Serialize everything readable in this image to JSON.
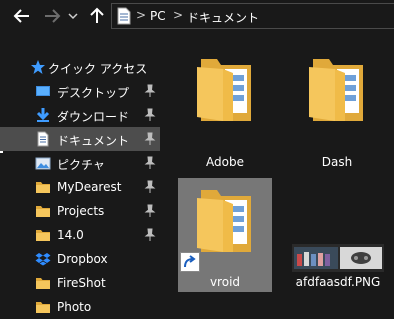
{
  "nav": {
    "back_icon": "back-arrow-icon",
    "forward_icon": "forward-arrow-icon",
    "down_icon": "chevron-down-icon",
    "up_icon": "up-arrow-icon"
  },
  "address": {
    "icon": "document-icon",
    "crumbs": [
      "PC",
      "ドキュメント"
    ],
    "separator": ">"
  },
  "sidebar": {
    "quick_access": {
      "label": "クイック アクセス",
      "icon": "star-icon"
    },
    "items": [
      {
        "label": "デスクトップ",
        "icon": "desktop-icon",
        "pinned": true
      },
      {
        "label": "ダウンロード",
        "icon": "download-icon",
        "pinned": true
      },
      {
        "label": "ドキュメント",
        "icon": "documents-icon",
        "pinned": true,
        "selected": true
      },
      {
        "label": "ピクチャ",
        "icon": "pictures-icon",
        "pinned": true
      },
      {
        "label": "MyDearest",
        "icon": "folder-icon",
        "pinned": true
      },
      {
        "label": "Projects",
        "icon": "folder-icon",
        "pinned": true
      },
      {
        "label": "14.0",
        "icon": "folder-icon",
        "pinned": true
      },
      {
        "label": "Dropbox",
        "icon": "dropbox-icon",
        "pinned": false
      },
      {
        "label": "FireShot",
        "icon": "folder-icon",
        "pinned": false
      },
      {
        "label": "Photo",
        "icon": "folder-icon",
        "pinned": false
      }
    ]
  },
  "files": [
    {
      "name": "Adobe",
      "type": "folder"
    },
    {
      "name": "Dash",
      "type": "folder"
    },
    {
      "name": "vroid",
      "type": "folder-shortcut",
      "selected": true
    },
    {
      "name": "afdfaasdf.PNG",
      "type": "image"
    }
  ],
  "colors": {
    "background": "#191919",
    "selection": "#4d4d4d",
    "tile_selection": "#777777",
    "folder_yellow": "#f5c65c",
    "folder_back": "#e0a93a"
  }
}
